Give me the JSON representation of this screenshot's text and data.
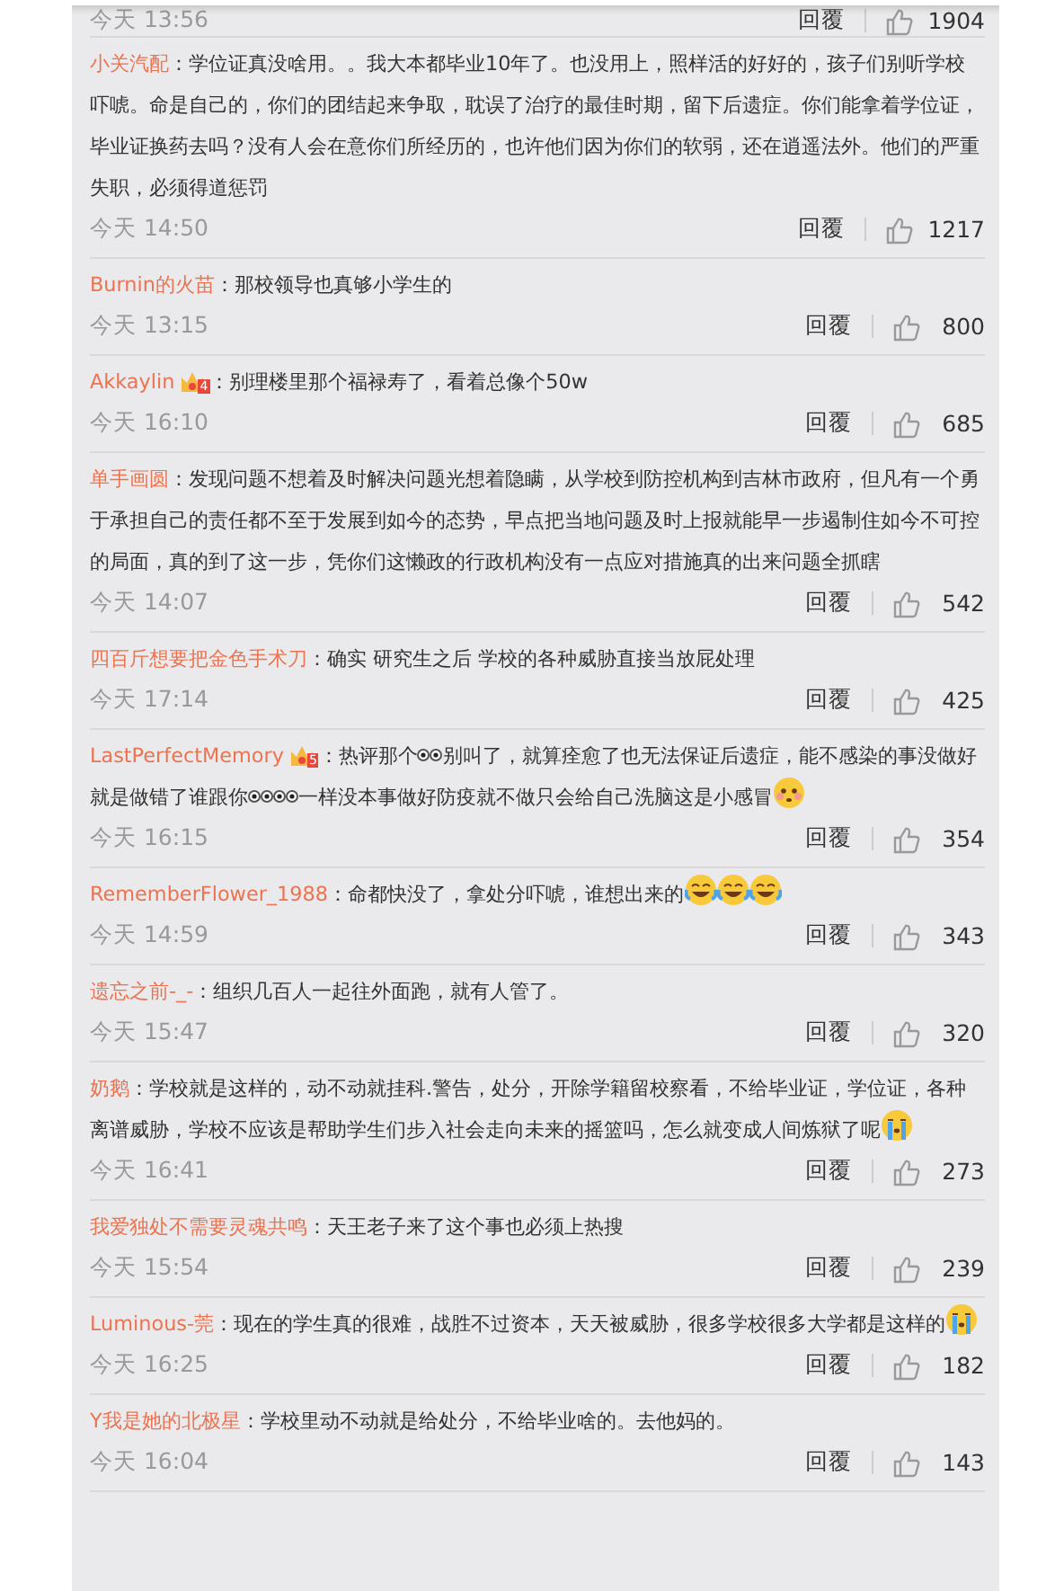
{
  "top_meta": {
    "time": "今天 13:56",
    "reply": "回覆",
    "likes": "1904"
  },
  "separator": "：",
  "comments": [
    {
      "user": "小关汽配",
      "body": [
        {
          "kind": "text",
          "text": "学位证真没啥用。。我大本都毕业10年了。也没用上，照样活的好好的，孩子们别听学校吓唬。命是自己的，你们的团结起来争取，耽误了治疗的最佳时期，留下后遗症。你们能拿着学位证，毕业证换药去吗？没有人会在意你们所经历的，也许他们因为你们的软弱，还在逍遥法外。他们的严重失职，必须得道惩罚"
        }
      ],
      "time": "今天 14:50",
      "reply": "回覆",
      "likes": "1217"
    },
    {
      "user": "Burnin的火苗",
      "body": [
        {
          "kind": "text",
          "text": "那校领导也真够小学生的"
        }
      ],
      "time": "今天 13:15",
      "reply": "回覆",
      "likes": "800"
    },
    {
      "user": "Akkaylin",
      "badge": "4",
      "body": [
        {
          "kind": "text",
          "text": "别理楼里那个福禄寿了，看着总像个50w"
        }
      ],
      "time": "今天 16:10",
      "reply": "回覆",
      "likes": "685"
    },
    {
      "user": "单手画圆",
      "body": [
        {
          "kind": "text",
          "text": "发现问题不想着及时解决问题光想着隐瞒，从学校到防控机构到吉林市政府，但凡有一个勇于承担自己的责任都不至于发展到如今的态势，早点把当地问题及时上报就能早一步遏制住如今不可控的局面，真的到了这一步，凭你们这懒政的行政机构没有一点应对措施真的出来问题全抓瞎"
        }
      ],
      "time": "今天 14:07",
      "reply": "回覆",
      "likes": "542"
    },
    {
      "user": "四百斤想要把金色手术刀",
      "body": [
        {
          "kind": "text",
          "text": "确实 研究生之后 学校的各种威胁直接当放屁处理"
        }
      ],
      "time": "今天 17:14",
      "reply": "回覆",
      "likes": "425"
    },
    {
      "user": "LastPerfectMemory",
      "badge": "5",
      "body": [
        {
          "kind": "text",
          "text": "热评那个"
        },
        {
          "kind": "eyes"
        },
        {
          "kind": "text",
          "text": "别叫了，就算痊愈了也无法保证后遗症，能不感染的事没做好就是做错了谁跟你"
        },
        {
          "kind": "eyes"
        },
        {
          "kind": "eyes"
        },
        {
          "kind": "text",
          "text": "一样没本事做好防疫就不做只会给自己洗脑这是小感冒"
        },
        {
          "kind": "shy"
        }
      ],
      "time": "今天 16:15",
      "reply": "回覆",
      "likes": "354"
    },
    {
      "user": "RememberFlower_1988",
      "body": [
        {
          "kind": "text",
          "text": "命都快没了，拿处分吓唬，谁想出来的"
        },
        {
          "kind": "laughcry"
        },
        {
          "kind": "laughcry"
        },
        {
          "kind": "laughcry"
        }
      ],
      "time": "今天 14:59",
      "reply": "回覆",
      "likes": "343"
    },
    {
      "user": "遗忘之前-_-",
      "body": [
        {
          "kind": "text",
          "text": "组织几百人一起往外面跑，就有人管了。"
        }
      ],
      "time": "今天 15:47",
      "reply": "回覆",
      "likes": "320"
    },
    {
      "user": "奶鹅",
      "body": [
        {
          "kind": "text",
          "text": "学校就是这样的，动不动就挂科.警告，处分，开除学籍留校察看，不给毕业证，学位证，各种离谱威胁，学校不应该是帮助学生们步入社会走向未来的摇篮吗，怎么就变成人间炼狱了呢"
        },
        {
          "kind": "cry"
        }
      ],
      "time": "今天 16:41",
      "reply": "回覆",
      "likes": "273"
    },
    {
      "user": "我爱独处不需要灵魂共鸣",
      "body": [
        {
          "kind": "text",
          "text": "天王老子来了这个事也必须上热搜"
        }
      ],
      "time": "今天 15:54",
      "reply": "回覆",
      "likes": "239"
    },
    {
      "user": "Luminous-莞",
      "body": [
        {
          "kind": "text",
          "text": "现在的学生真的很难，战胜不过资本，天天被威胁，很多学校很多大学都是这样的"
        },
        {
          "kind": "cry"
        }
      ],
      "time": "今天 16:25",
      "reply": "回覆",
      "likes": "182"
    },
    {
      "user": "Y我是她的北极星",
      "body": [
        {
          "kind": "text",
          "text": "学校里动不动就是给处分，不给毕业啥的。去他妈的。"
        }
      ],
      "time": "今天 16:04",
      "reply": "回覆",
      "likes": "143"
    }
  ]
}
